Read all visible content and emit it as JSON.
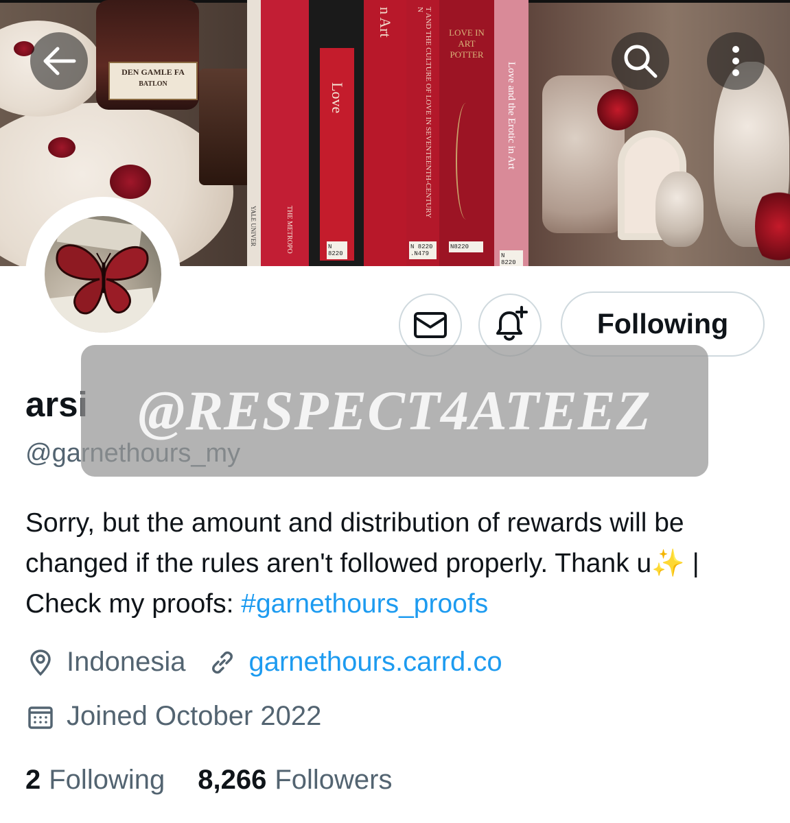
{
  "banner": {
    "jar_label": "DEN GAMLE FA",
    "jar_sublabel": "BATLON",
    "books": [
      {
        "title": "Love"
      },
      {
        "title": "n Art"
      },
      {
        "title": "T AND THE CULTURE OF LOVE IN SEVENTEENTH-CENTURY N"
      },
      {
        "title": "LOVE IN ART POTTER"
      },
      {
        "title": "Love and the Erotic in Art"
      }
    ],
    "spine_small": "THE METROPO",
    "spine_small2": "YALE UNIVER",
    "tags": [
      "N 8220",
      "N 8220 .N479",
      "N8220",
      "N 8220"
    ]
  },
  "nav": {
    "back_icon": "arrow-left-icon",
    "search_icon": "search-icon",
    "more_icon": "more-vertical-icon"
  },
  "actions": {
    "message_icon": "envelope-icon",
    "notify_icon": "bell-plus-icon",
    "following_label": "Following"
  },
  "profile": {
    "display_name": "arsi",
    "handle": "@garnethours_my",
    "bio_text": "Sorry, but the amount and distribution of rewards will be changed if the rules aren't followed properly. Thank u✨ | Check my proofs: ",
    "bio_hashtag": "#garnethours_proofs",
    "location": "Indonesia",
    "website": "garnethours.carrd.co",
    "joined": "Joined October 2022",
    "following_count": "2",
    "following_label": "Following",
    "followers_count": "8,266",
    "followers_label": "Followers"
  },
  "watermark": {
    "text": "@RESPECT4ATEEZ"
  },
  "colors": {
    "link": "#1d9bf0",
    "secondary_text": "#536471",
    "primary_text": "#0f1419",
    "border": "#cfd9de"
  }
}
